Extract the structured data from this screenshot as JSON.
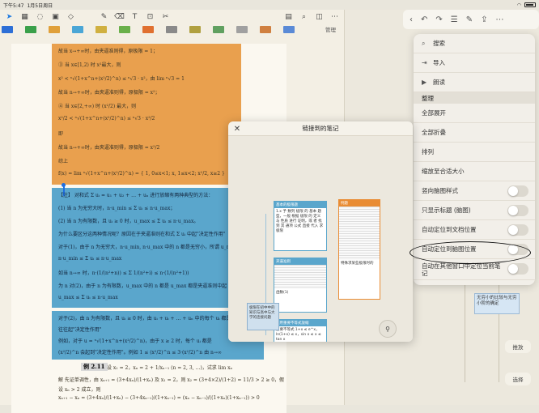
{
  "status": {
    "time": "下午5:47",
    "date": "1月5日周日",
    "battery": ""
  },
  "left": {
    "manage_label": "管理",
    "swatch_colors": [
      "#2d6fd6",
      "#3aa04a",
      "#e0a03a",
      "#4aa6d6",
      "#d0b040",
      "#6ab04a",
      "#e07030",
      "#8a8a8a",
      "#b0a040",
      "#60a060",
      "#a0a0a0",
      "#d08040",
      "#5a8ad6"
    ],
    "page_lines": [
      "故当 x→+∞时，由夹逼准则得，原极限 = 1；",
      "③ 当 x∈[1,2) 时 x²最大，则",
      "x² < ⁿ√(1+x^n+(x²/2)^n) ≤ ⁿ√3 · x²，由 lim ⁿ√3 = 1",
      "故当 n→+∞时，由夹逼准则得，原极限 = x²；",
      "④ 当 x∈[2,+∞) 时 (x²/2) 最大，则",
      "x²/2 < ⁿ√(1+x^n+(x²/2)^n) ≤ ⁿ√3 · x²/2",
      "即",
      "故当 n→+∞时，由夹逼准则得，原极限 = x²/2",
      "综上",
      "f(x) = lim ⁿ√(1+x^n+(x²/2)^n) = { 1, 0≤x<1; x, 1≤x<2; x²/2, x≥2 }"
    ],
    "blue_lines": [
      "【注】 对和式 Σ uᵢ = u₁ + u₂ + … + uₙ 进行放缩有两种典型的方法：",
      "(1) 当 n 为无穷大时，n·u_min ≤ Σ uᵢ ≤ n·u_max；",
      "(2) 当 n 为有限数，且 uᵢ ≥ 0 时，u_max ≤ Σ uᵢ ≤ n·u_max。",
      "为什么要区分这两种情况呢？原因在于夹逼准则在和式 Σ uᵢ 中起\"决定性作用\"",
      "对于(1)，由于 n 为无穷大，n·u_min, n·u_max 中的 n 都是无穷小，所谓 u_max",
      "n·u_min ≤ Σ uᵢ ≤ n·u_max",
      "如当 n→∞ 时，n·(1/(n²+n)) ≤ Σ 1/(n²+i) ≤ n·(1/(n²+1))",
      "为 n 对(2)，由于 n 为有限数，u_max 中的 n 都是 u_max 都是夹逼准则中起",
      "u_max ≤ Σ uᵢ ≤ n·u_max"
    ],
    "blue2_lines": [
      "对于(2)，由 n 为有限数，且 uᵢ ≥ 0 时，由 uᵢ + uᵢ + … + uₙ 中的每个 uᵢ 都是",
      "往往起\"决定性作用\"",
      "例如，对于 u = ⁿ√(1+x^n+(x²/2)^n)，由于 x ≥ 2 时，每个 uᵢ 都是",
      "(x²/2)^n 会起到\"决定性作用\"。例如 1 ≤ (x²/2)^n ≤ 3·(x²/2)^n 由 n→∞"
    ],
    "example_label": "例 2.11",
    "lower_lines": [
      "设 x₁ = 2，xₙ = 2 + 1/xₙ₋₁ (n = 2, 3, …)，试求 lim xₙ",
      "解  先证单调性，由 xₙ₊₁ = (3+4xₙ)/(1+xₙ) 及 x₁ = 2，则 x₂ = (3+4×2)/(1+2) = 11/3 > 2 ≥ 0，假",
      "设 xₙ > 2 成立，则",
      "xₙ₊₁ − xₙ = (3+4xₙ)/(1+xₙ) − (3+4xₙ₋₁)/(1+xₙ₋₁) = (xₙ − xₙ₋₁)/((1+xₙ)(1+xₙ₋₁)) > 0"
    ]
  },
  "modal": {
    "title": "链接到的笔记",
    "cards": [
      {
        "caption": "基本的极限题",
        "text": "1.x 予 数列 极限 的 基本 题 型，一般 根据 极限 的 定义 与 性质 进行 证明，或 者 找到 其 通项 公式 直接 代入 求极限"
      },
      {
        "caption": "夹逼准则",
        "text": "当 n→∞ 时 n 为 无穷大 的 数列 可 以 利用 夹逼 准则 求 极限"
      },
      {
        "caption": "函数(1)",
        "text": ""
      },
      {
        "caption": "利用重要不等式放缩",
        "text": "重要不等式 1+x ≤ e^x，ln(1+x) ≤ x，sin x ≤ x ≤ tan x"
      }
    ],
    "card_labels": [
      "例题",
      "特殊求某些极限时的",
      "函数(1)"
    ],
    "tooltip": "极限在初中中的知识与高中与大学的连接问题"
  },
  "menu": {
    "items": [
      {
        "label": "搜索",
        "icon": "search-icon"
      },
      {
        "label": "导入",
        "icon": "import-icon"
      },
      {
        "label": "朗读",
        "icon": "speaker-icon"
      }
    ],
    "group_label": "整理",
    "group_items": [
      {
        "label": "全部展开"
      },
      {
        "label": "全部折叠"
      },
      {
        "label": "排列"
      },
      {
        "label": "缩放至合适大小"
      }
    ],
    "toggles": [
      {
        "label": "竖向脑图样式",
        "on": false
      },
      {
        "label": "只显示标题 (脑图)",
        "on": false
      },
      {
        "label": "自动定位到文档位置",
        "on": false
      },
      {
        "label": "自动定位到脑图位置",
        "on": false
      },
      {
        "label": "自动在其他窗口中定位当前笔记",
        "on": false
      }
    ]
  },
  "right": {
    "sticky_note": "无穷小的比较与无穷小阶的确定",
    "buttons": [
      "推放",
      "选择"
    ]
  }
}
